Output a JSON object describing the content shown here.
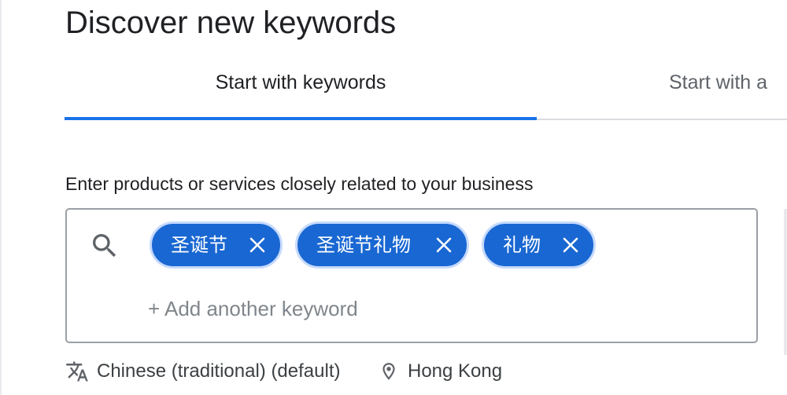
{
  "page": {
    "title": "Discover new keywords"
  },
  "tabs": [
    {
      "label": "Start with keywords",
      "selected": true
    },
    {
      "label": "Start with a",
      "selected": false
    }
  ],
  "keyword_input": {
    "prompt": "Enter products or services closely related to your business",
    "search_icon": "search-icon",
    "chips": [
      {
        "label": "圣诞节",
        "remove_icon": "close-icon"
      },
      {
        "label": "圣诞节礼物",
        "remove_icon": "close-icon"
      },
      {
        "label": "礼物",
        "remove_icon": "close-icon"
      }
    ],
    "add_placeholder": "+ Add another keyword"
  },
  "settings": {
    "language_icon": "translate-icon",
    "language": "Chinese (traditional) (default)",
    "location_icon": "location-pin-icon",
    "location": "Hong Kong"
  },
  "colors": {
    "accent": "#1a73e8",
    "chip_background": "#1967d2",
    "chip_border": "#c6dafc",
    "placeholder_text": "#80868b"
  }
}
